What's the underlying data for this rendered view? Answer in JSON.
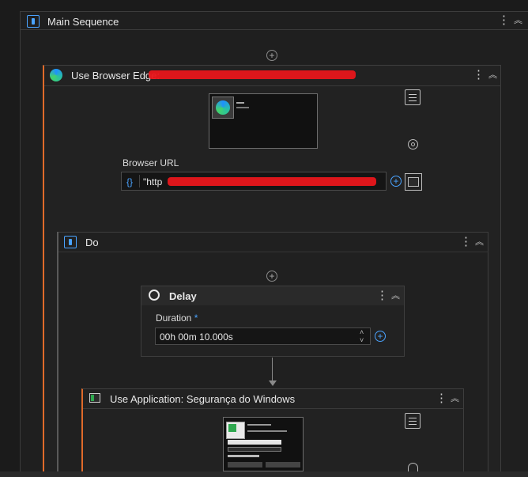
{
  "main_sequence": {
    "title": "Main Sequence",
    "icon": "sequence-icon"
  },
  "browser_activity": {
    "title": "Use Browser Edge:",
    "browser_url_label": "Browser URL",
    "url_prefix": "\"http",
    "url_brace": "{}",
    "icons": [
      "edge-icon",
      "menu-icon",
      "target-icon",
      "add-icon",
      "browser-window-icon"
    ],
    "accent": "#e06a2a"
  },
  "do_block": {
    "title": "Do",
    "icon": "sequence-icon"
  },
  "delay": {
    "title": "Delay",
    "duration_label": "Duration",
    "required_mark": "*",
    "duration_value": "00h 00m 10.000s"
  },
  "use_application": {
    "title": "Use Application: Segurança do Windows"
  }
}
